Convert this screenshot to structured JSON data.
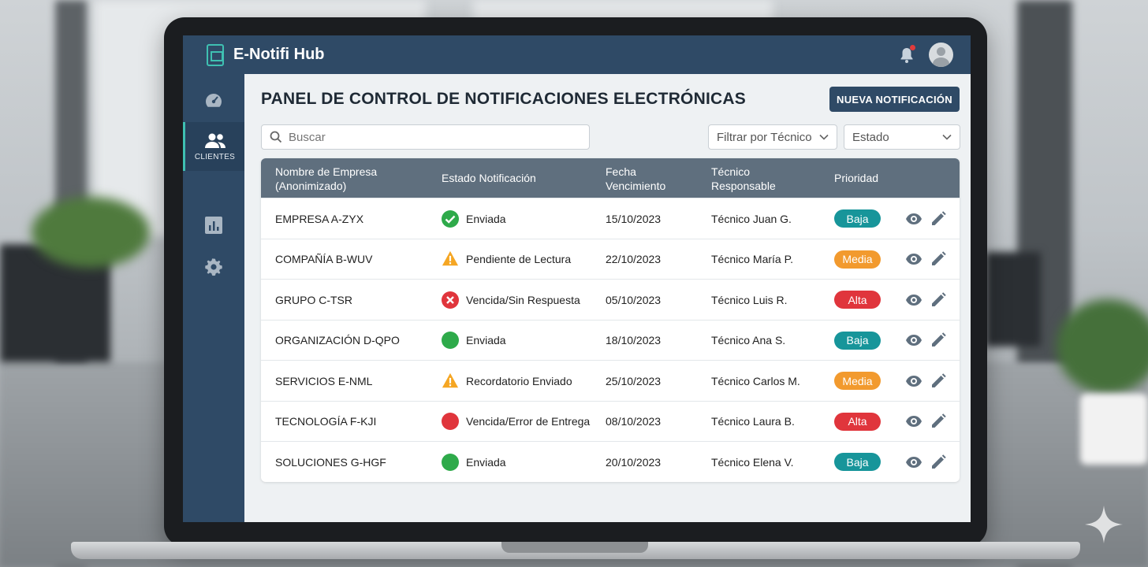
{
  "app": {
    "title": "E-Notifi Hub"
  },
  "sidebar": {
    "items": [
      {
        "icon": "dashboard-icon",
        "label": ""
      },
      {
        "icon": "users-icon",
        "label": "CLIENTES"
      },
      {
        "icon": "chart-icon",
        "label": ""
      },
      {
        "icon": "gear-icon",
        "label": ""
      }
    ]
  },
  "page": {
    "title": "PANEL DE CONTROL DE NOTIFICACIONES ELECTRÓNICAS",
    "new_button": "NUEVA NOTIFICACIÓN"
  },
  "filters": {
    "search_placeholder": "Buscar",
    "technician_select": "Filtrar por Técnico",
    "status_select": "Estado"
  },
  "table": {
    "headers": {
      "company_line1": "Nombre de Empresa",
      "company_line2": "(Anonimizado)",
      "status": "Estado Notificación",
      "due_line1": "Fecha",
      "due_line2": "Vencimiento",
      "tech_line1": "Técnico",
      "tech_line2": "Responsable",
      "priority": "Prioridad"
    },
    "rows": [
      {
        "company": "EMPRESA A-ZYX",
        "status": "Enviada",
        "status_icon": "check-circle-icon",
        "due": "15/10/2023",
        "tech": "Técnico Juan G.",
        "priority": "Baja"
      },
      {
        "company": "COMPAÑÍA B-WUV",
        "status": "Pendiente de Lectura",
        "status_icon": "warning-icon",
        "due": "22/10/2023",
        "tech": "Técnico María P.",
        "priority": "Media"
      },
      {
        "company": "GRUPO C-TSR",
        "status": "Vencida/Sin Respuesta",
        "status_icon": "x-circle-icon",
        "due": "05/10/2023",
        "tech": "Técnico Luis R.",
        "priority": "Alta"
      },
      {
        "company": "ORGANIZACIÓN D-QPO",
        "status": "Enviada",
        "status_icon": "green-dot-icon",
        "due": "18/10/2023",
        "tech": "Técnico Ana S.",
        "priority": "Baja"
      },
      {
        "company": "SERVICIOS E-NML",
        "status": "Recordatorio Enviado",
        "status_icon": "warning-icon",
        "due": "25/10/2023",
        "tech": "Técnico Carlos M.",
        "priority": "Media"
      },
      {
        "company": "TECNOLOGÍA F-KJI",
        "status": "Vencida/Error de Entrega",
        "status_icon": "red-dot-icon",
        "due": "08/10/2023",
        "tech": "Técnico Laura B.",
        "priority": "Alta"
      },
      {
        "company": "SOLUCIONES G-HGF",
        "status": "Enviada",
        "status_icon": "green-dot-icon",
        "due": "20/10/2023",
        "tech": "Técnico Elena V.",
        "priority": "Baja"
      }
    ]
  },
  "colors": {
    "topbar": "#2f4a66",
    "accent": "#3fc0b2",
    "priority_baja": "#17959a",
    "priority_media": "#f29a2e",
    "priority_alta": "#e0353c",
    "status_green": "#2eaa4a",
    "status_red": "#e0353c",
    "status_amber": "#f5a623"
  }
}
